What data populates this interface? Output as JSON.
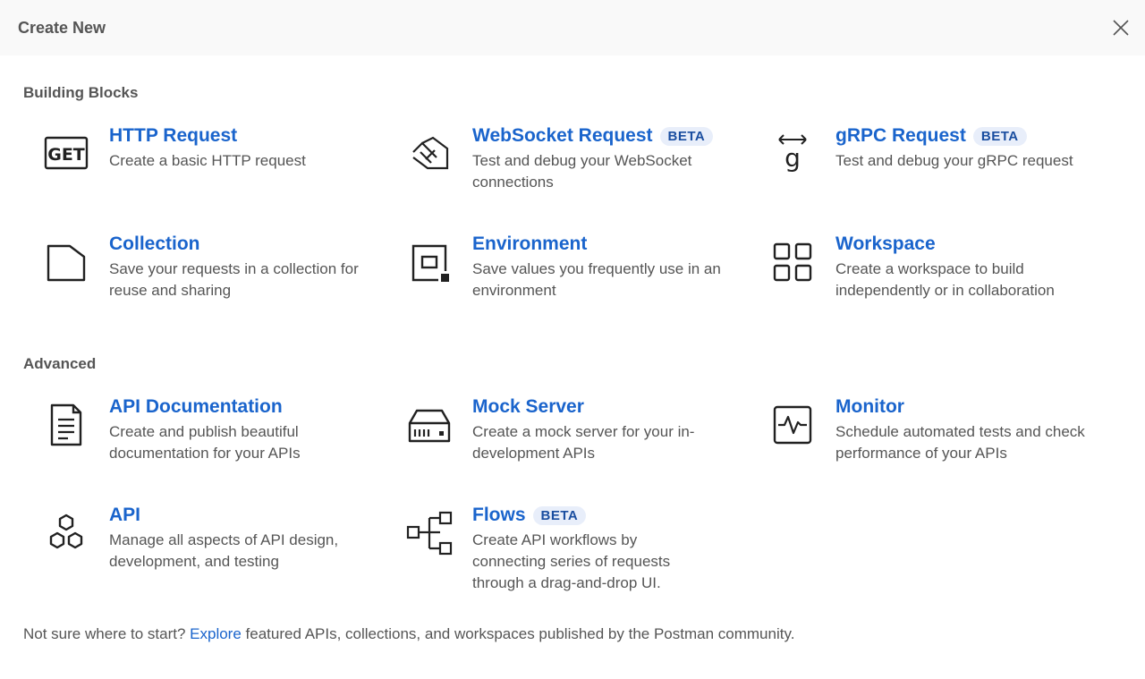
{
  "dialog": {
    "title": "Create New"
  },
  "sections": {
    "building_blocks": {
      "title": "Building Blocks"
    },
    "advanced": {
      "title": "Advanced"
    }
  },
  "items": {
    "http": {
      "name": "HTTP Request",
      "desc": "Create a basic HTTP request",
      "icon": "get-icon",
      "icon_text": "GET"
    },
    "websocket": {
      "name": "WebSocket Request",
      "badge": "BETA",
      "desc": "Test and debug your WebSocket connections",
      "icon": "websocket-icon"
    },
    "grpc": {
      "name": "gRPC Request",
      "badge": "BETA",
      "desc": "Test and debug your gRPC request",
      "icon": "grpc-icon"
    },
    "collection": {
      "name": "Collection",
      "desc": "Save your requests in a collection for reuse and sharing",
      "icon": "collection-icon"
    },
    "environment": {
      "name": "Environment",
      "desc": "Save values you frequently use in an environment",
      "icon": "environment-icon"
    },
    "workspace": {
      "name": "Workspace",
      "desc": "Create a workspace to build independently or in collaboration",
      "icon": "workspace-icon"
    },
    "api_docs": {
      "name": "API Documentation",
      "desc": "Create and publish beautiful documentation for your APIs",
      "icon": "document-icon"
    },
    "mock": {
      "name": "Mock Server",
      "desc": "Create a mock server for your in-development APIs",
      "icon": "server-icon"
    },
    "monitor": {
      "name": "Monitor",
      "desc": "Schedule automated tests and check performance of your APIs",
      "icon": "monitor-icon"
    },
    "api": {
      "name": "API",
      "desc": "Manage all aspects of API design, development, and testing",
      "icon": "api-icon"
    },
    "flows": {
      "name": "Flows",
      "badge": "BETA",
      "desc": "Create API workflows by connecting series of requests through a drag-and-drop UI.",
      "icon": "flows-icon"
    }
  },
  "footer": {
    "prefix": "Not sure where to start?",
    "link": "Explore",
    "suffix": "featured APIs, collections, and workspaces published by the Postman community."
  },
  "colors": {
    "link": "#1a64cc",
    "badge_bg": "#e8eefa",
    "header_bg": "#f9f9f9"
  }
}
